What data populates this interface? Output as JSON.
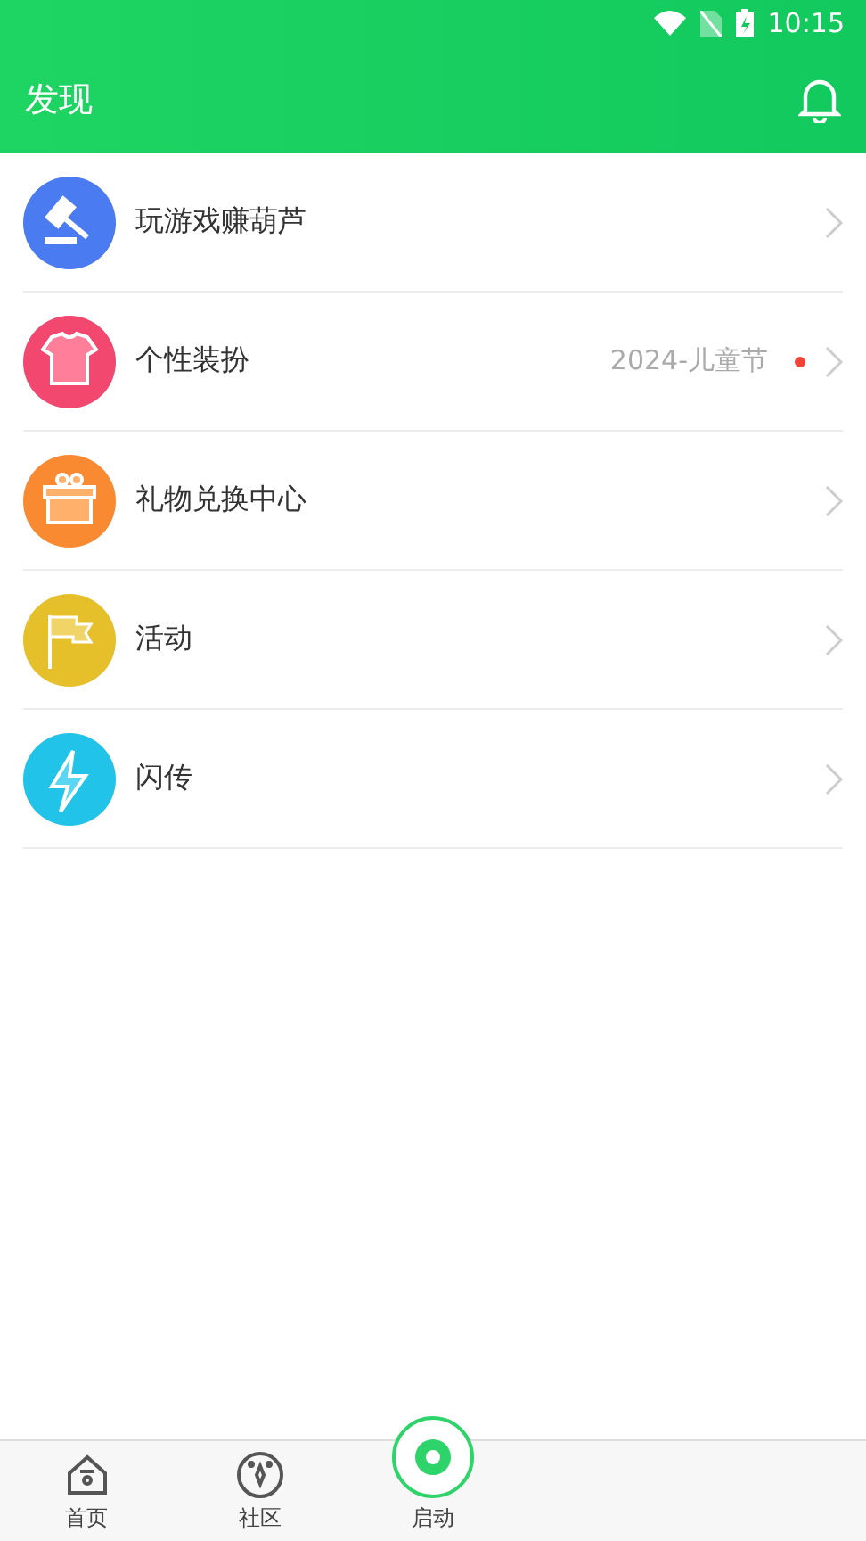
{
  "status_bar": {
    "time": "10:15"
  },
  "header": {
    "title": "发现"
  },
  "items": [
    {
      "kind": "gavel",
      "color": "#4a7bf0",
      "label": "玩游戏赚葫芦"
    },
    {
      "kind": "shirt",
      "color": "#f2486f",
      "label": "个性装扮",
      "note": "2024-儿童节",
      "dot": true
    },
    {
      "kind": "gift",
      "color": "#fa8a32",
      "label": "礼物兑换中心"
    },
    {
      "kind": "flag",
      "color": "#e6c02a",
      "label": "活动"
    },
    {
      "kind": "bolt",
      "color": "#22c3e8",
      "label": "闪传"
    }
  ],
  "tabs": [
    {
      "kind": "home",
      "label": "首页",
      "selected": false
    },
    {
      "kind": "community",
      "label": "社区",
      "selected": false
    },
    {
      "kind": "launch",
      "label": "启动",
      "selected": false
    }
  ]
}
